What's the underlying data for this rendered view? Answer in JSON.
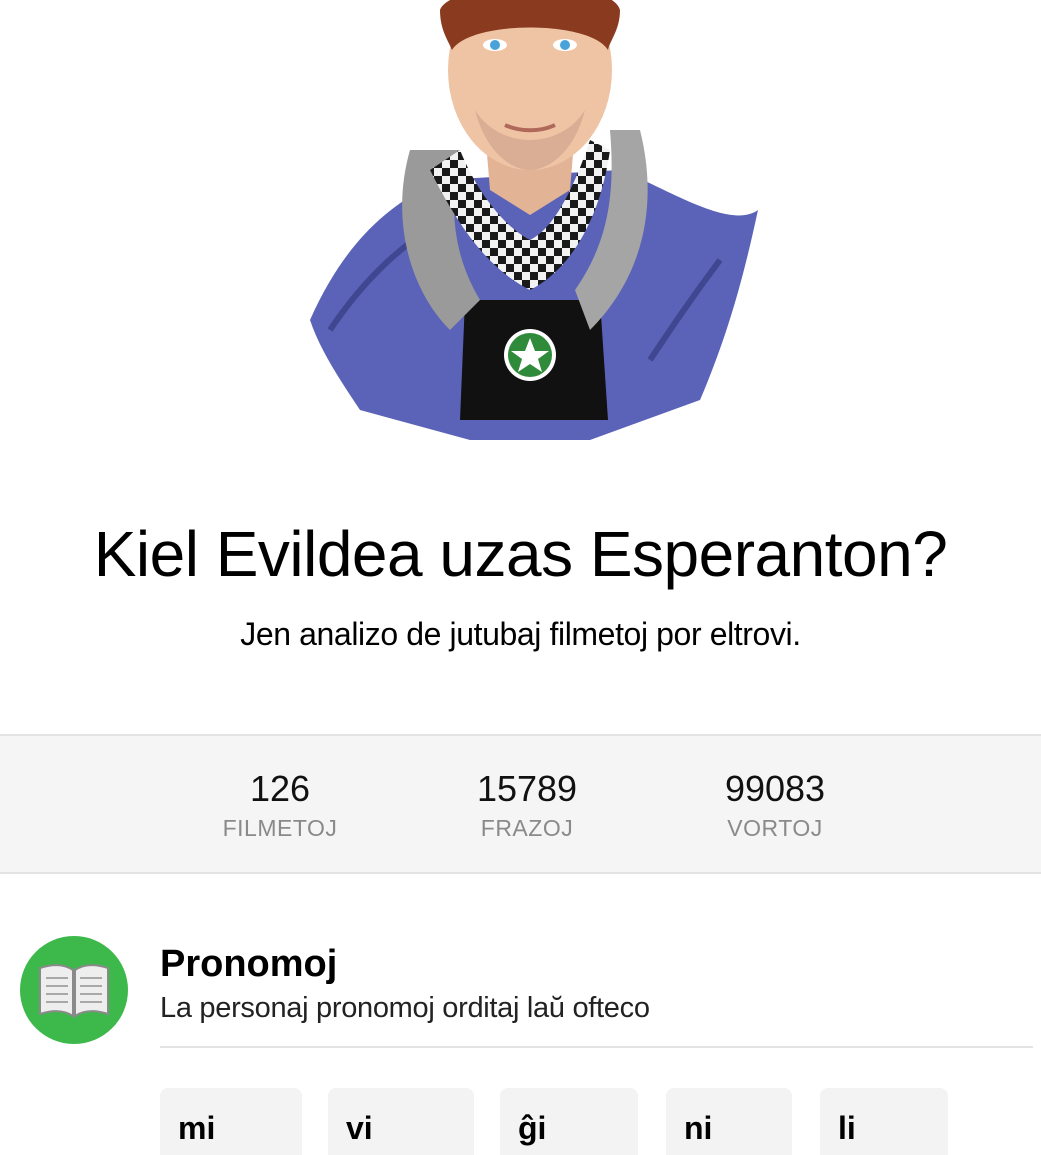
{
  "hero": {
    "title": "Kiel Evildea uzas Esperanton?",
    "subtitle": "Jen analizo de jutubaj filmetoj por eltrovi."
  },
  "stats": [
    {
      "value": "126",
      "label": "FILMETOJ"
    },
    {
      "value": "15789",
      "label": "FRAZOJ"
    },
    {
      "value": "99083",
      "label": "VORTOJ"
    }
  ],
  "section": {
    "icon": "open-book-icon",
    "title": "Pronomoj",
    "description": "La personaj pronomoj orditaj laŭ ofteco"
  },
  "pronouns": [
    {
      "word": "mi"
    },
    {
      "word": "vi"
    },
    {
      "word": "ĝi"
    },
    {
      "word": "ni"
    },
    {
      "word": "li"
    }
  ],
  "colors": {
    "accent_green": "#3db84a",
    "stats_bg": "#f5f5f5",
    "muted_text": "#8a8a8a"
  }
}
